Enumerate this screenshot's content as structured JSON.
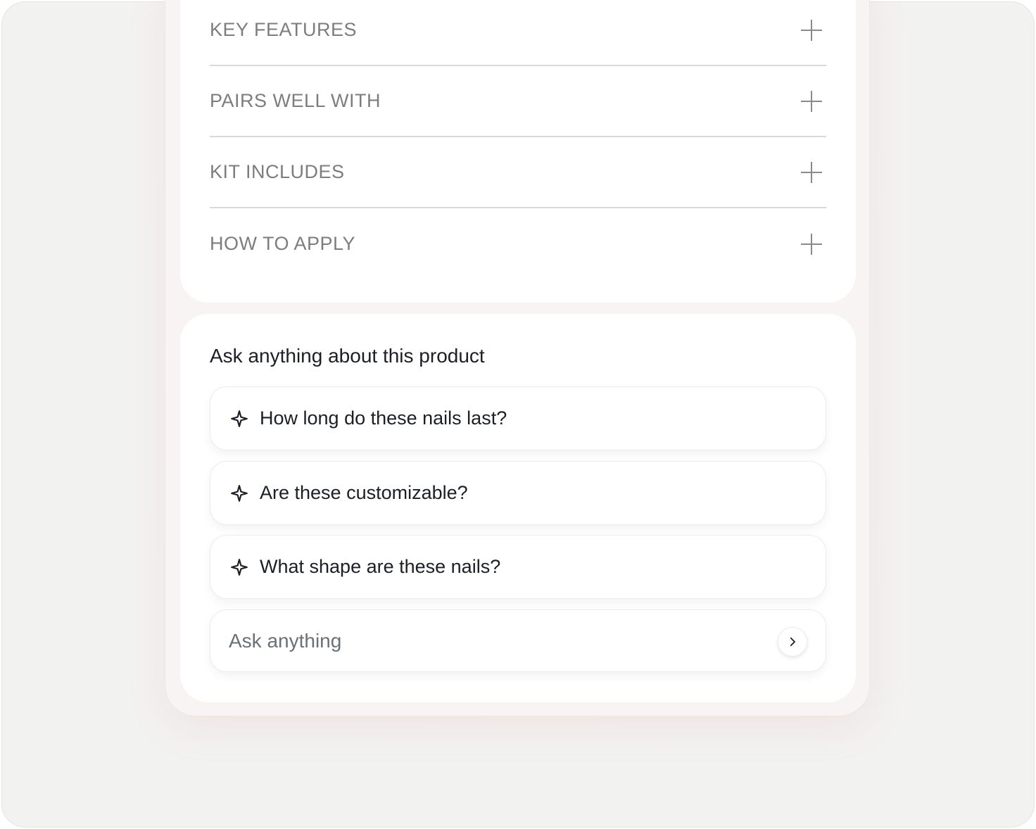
{
  "accordion": {
    "items": [
      {
        "label": "KEY FEATURES"
      },
      {
        "label": "PAIRS WELL WITH"
      },
      {
        "label": "KIT INCLUDES"
      },
      {
        "label": "HOW TO APPLY"
      }
    ]
  },
  "ask": {
    "title": "Ask anything about this product",
    "suggestions": [
      {
        "text": "How long do these nails last?",
        "icon": "sparkle-icon"
      },
      {
        "text": "Are these customizable?",
        "icon": "sparkle-icon"
      },
      {
        "text": "What shape are these nails?",
        "icon": "sparkle-icon"
      }
    ],
    "input": {
      "placeholder": "Ask anything",
      "value": ""
    },
    "send_icon": "chevron-right-icon"
  },
  "colors": {
    "text_dark": "#1c1f26",
    "accordion_text": "#7d7d7d",
    "divider": "#d9d9d9",
    "background_glow": "#fbecea"
  }
}
